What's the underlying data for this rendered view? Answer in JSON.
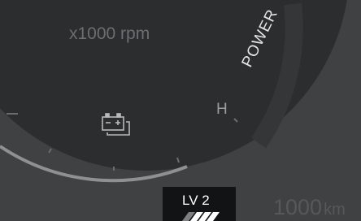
{
  "gauge": {
    "unit_label": "x1000 rpm",
    "mode_label": "POWER",
    "temp_high_label": "H",
    "battery_icon": "battery-warning-icon"
  },
  "level_indicator": {
    "label": "LV 2",
    "icon": "level-stripes-icon"
  },
  "odometer": {
    "value": "1000",
    "unit": "km"
  },
  "colors": {
    "background": "#3f4143",
    "dial_face": "#2b2d2f",
    "dial_rim": "#8e9092",
    "level_box": "#121314"
  }
}
